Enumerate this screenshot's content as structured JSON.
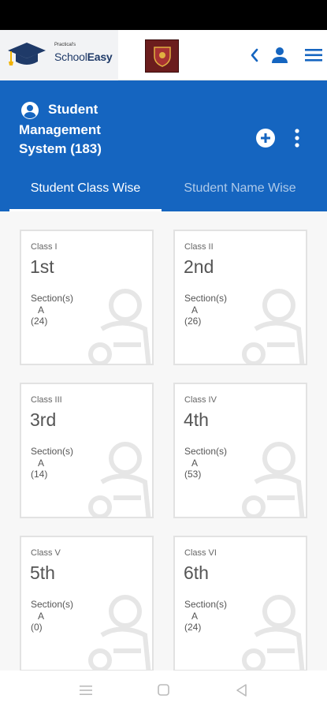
{
  "brand": {
    "small": "Practical's",
    "name_part1": "School",
    "name_part2": "Easy"
  },
  "header": {
    "title_line1": "Student",
    "title_line2": "Management",
    "title_line3": "System (183)"
  },
  "tabs": [
    {
      "label": "Student Class Wise",
      "active": true
    },
    {
      "label": "Student Name Wise",
      "active": false
    }
  ],
  "sections_label": "Section(s)",
  "classes": [
    {
      "label": "Class I",
      "ordinal": "1st",
      "section": "A",
      "count": "(24)"
    },
    {
      "label": "Class II",
      "ordinal": "2nd",
      "section": "A",
      "count": "(26)"
    },
    {
      "label": "Class III",
      "ordinal": "3rd",
      "section": "A",
      "count": "(14)"
    },
    {
      "label": "Class IV",
      "ordinal": "4th",
      "section": "A",
      "count": "(53)"
    },
    {
      "label": "Class V",
      "ordinal": "5th",
      "section": "A",
      "count": "(0)"
    },
    {
      "label": "Class VI",
      "ordinal": "6th",
      "section": "A",
      "count": "(24)"
    }
  ],
  "colors": {
    "primary": "#1565c0",
    "logo_blue": "#1f3a68",
    "cap_yellow": "#f2b300"
  }
}
